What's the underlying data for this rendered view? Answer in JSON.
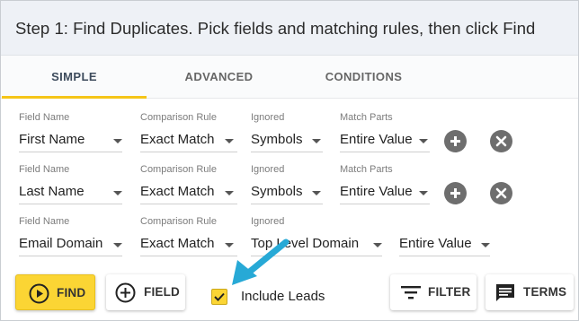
{
  "header": {
    "title": "Step 1: Find Duplicates. Pick fields and matching rules, then click Find"
  },
  "tabs": [
    {
      "label": "SIMPLE",
      "active": true
    },
    {
      "label": "ADVANCED",
      "active": false
    },
    {
      "label": "CONDITIONS",
      "active": false
    }
  ],
  "column_labels": {
    "field_name": "Field Name",
    "comparison_rule": "Comparison Rule",
    "ignored": "Ignored",
    "match_parts": "Match Parts"
  },
  "rows": [
    {
      "field_name": "First Name",
      "comparison_rule": "Exact Match",
      "ignored": "Symbols",
      "match_parts": "Entire Value"
    },
    {
      "field_name": "Last Name",
      "comparison_rule": "Exact Match",
      "ignored": "Symbols",
      "match_parts": "Entire Value"
    },
    {
      "field_name": "Email Domain",
      "comparison_rule": "Exact Match",
      "ignored": "Top Level Domain",
      "match_parts": "Entire Value"
    }
  ],
  "actions": {
    "find_label": "FIND",
    "field_label": "FIELD",
    "include_leads_label": "Include Leads",
    "include_leads_checked": true,
    "filter_label": "FILTER",
    "terms_label": "TERMS"
  },
  "colors": {
    "accent": "#fbd534",
    "arrow": "#27a9d6",
    "header_bg": "#eef1f6",
    "icon_grey": "#6e6e6e"
  },
  "icons": [
    "chevron-down-icon",
    "plus-circle-icon",
    "close-circle-icon",
    "play-circle-icon",
    "add-circle-outline-icon",
    "checkmark-icon",
    "filter-icon",
    "message-icon",
    "arrow-pointer-icon"
  ]
}
